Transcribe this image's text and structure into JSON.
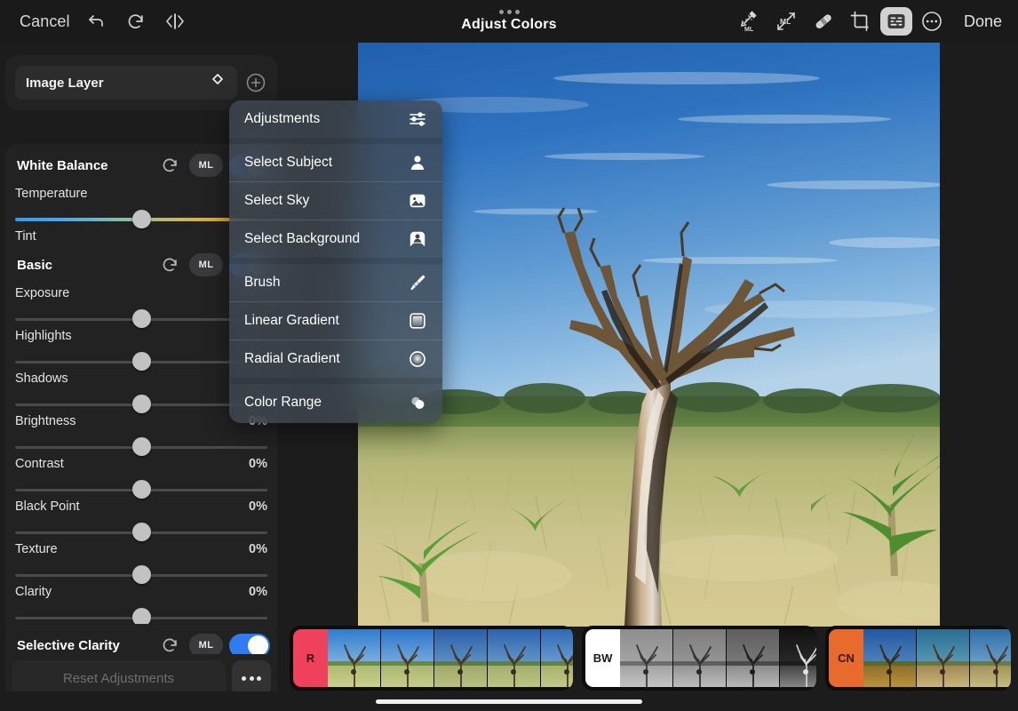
{
  "topbar": {
    "cancel_label": "Cancel",
    "done_label": "Done",
    "title": "Adjust Colors",
    "left_icons": [
      {
        "name": "undo-icon"
      },
      {
        "name": "redo-icon"
      },
      {
        "name": "compare-before-after-icon"
      }
    ],
    "right_icons": [
      {
        "name": "magic-wand-ml-icon"
      },
      {
        "name": "ml-resize-icon"
      },
      {
        "name": "healing-bandage-icon"
      },
      {
        "name": "crop-icon"
      },
      {
        "name": "adjustments-panel-icon",
        "active": true
      },
      {
        "name": "more-circle-icon"
      }
    ]
  },
  "left_panel": {
    "layer": {
      "selected": "Image Layer",
      "chevron_icon": "chevron-up-down-icon",
      "add_icon": "plus-circle-icon"
    },
    "sections": [
      {
        "id": "white-balance",
        "title": "White Balance",
        "reset_icon": "reset-arrow-icon",
        "ml_label": "ML",
        "toggle_on": true,
        "sliders": [
          {
            "label": "Temperature",
            "value": "",
            "pos": 50,
            "gradient": "temp"
          },
          {
            "label": "Tint",
            "value": "",
            "pos": 50,
            "gradient": "tint"
          }
        ]
      },
      {
        "id": "basic",
        "title": "Basic",
        "reset_icon": "reset-arrow-icon",
        "ml_label": "ML",
        "toggle_on": true,
        "sliders": [
          {
            "label": "Exposure",
            "value": "",
            "pos": 50,
            "gradient": "plain"
          },
          {
            "label": "Highlights",
            "value": "",
            "pos": 50,
            "gradient": "plain"
          },
          {
            "label": "Shadows",
            "value": "",
            "pos": 50,
            "gradient": "plain"
          },
          {
            "label": "Brightness",
            "value": "0%",
            "pos": 50,
            "gradient": "plain"
          },
          {
            "label": "Contrast",
            "value": "0%",
            "pos": 50,
            "gradient": "plain"
          },
          {
            "label": "Black Point",
            "value": "0%",
            "pos": 50,
            "gradient": "plain"
          },
          {
            "label": "Texture",
            "value": "0%",
            "pos": 50,
            "gradient": "plain"
          },
          {
            "label": "Clarity",
            "value": "0%",
            "pos": 50,
            "gradient": "plain"
          }
        ]
      },
      {
        "id": "selective-clarity",
        "title": "Selective Clarity",
        "reset_icon": "reset-arrow-icon",
        "ml_label": "ML",
        "toggle_on": true,
        "sliders": []
      }
    ],
    "footer": {
      "reset_label": "Reset Adjustments",
      "more_icon": "more-dots-icon"
    }
  },
  "menu": {
    "items": [
      {
        "label": "Adjustments",
        "icon": "sliders-icon",
        "sep_after": "gap"
      },
      {
        "label": "Select Subject",
        "icon": "person-icon",
        "sep_after": "line"
      },
      {
        "label": "Select Sky",
        "icon": "sky-image-icon",
        "sep_after": "line"
      },
      {
        "label": "Select Background",
        "icon": "background-person-icon",
        "sep_after": "gap"
      },
      {
        "label": "Brush",
        "icon": "brush-icon",
        "sep_after": "line"
      },
      {
        "label": "Linear Gradient",
        "icon": "linear-gradient-icon",
        "sep_after": "line"
      },
      {
        "label": "Radial Gradient",
        "icon": "radial-gradient-icon",
        "sep_after": "gap"
      },
      {
        "label": "Color Range",
        "icon": "color-range-icon",
        "sep_after": "none"
      }
    ]
  },
  "filmstrip": {
    "groups": [
      {
        "chip_label": "R",
        "chip_color": "#f0415c",
        "chip_text_color": "#3a0a12",
        "thumbs": [
          {
            "name": "preset-r-1",
            "sky_top": "#2f7ccd",
            "sky_bot": "#7fb3e0",
            "ground_top": "#a8b870",
            "ground_bot": "#ccd08a"
          },
          {
            "name": "preset-r-2",
            "sky_top": "#2b73c9",
            "sky_bot": "#79aede",
            "ground_top": "#a5b56e",
            "ground_bot": "#c9cd88"
          },
          {
            "name": "preset-r-3",
            "sky_top": "#2a5fa8",
            "sky_bot": "#5f93c4",
            "ground_top": "#9aa868",
            "ground_bot": "#bcc07e"
          },
          {
            "name": "preset-r-4",
            "sky_top": "#2c63ad",
            "sky_bot": "#6599c9",
            "ground_top": "#9eac6b",
            "ground_bot": "#c0c482"
          },
          {
            "name": "preset-r-5",
            "sky_top": "#2e69b5",
            "sky_bot": "#6c9fd0",
            "ground_top": "#a2b06d",
            "ground_bot": "#c4c884"
          }
        ]
      },
      {
        "chip_label": "BW",
        "chip_color": "#ffffff",
        "chip_text_color": "#1a1a1a",
        "thumbs": [
          {
            "name": "preset-bw-1",
            "sky_top": "#8e8e8e",
            "sky_bot": "#a5a5a5",
            "ground_top": "#9e9e9e",
            "ground_bot": "#c4c4c4"
          },
          {
            "name": "preset-bw-2",
            "sky_top": "#7d7d7d",
            "sky_bot": "#969696",
            "ground_top": "#8f8f8f",
            "ground_bot": "#bcbcbc"
          },
          {
            "name": "preset-bw-3",
            "sky_top": "#5e5e5e",
            "sky_bot": "#7a7a7a",
            "ground_top": "#868686",
            "ground_bot": "#b8b8b8"
          },
          {
            "name": "preset-bw-4",
            "sky_top": "#111111",
            "sky_bot": "#2a2a2a",
            "ground_top": "#3a3a3a",
            "ground_bot": "#858585"
          }
        ]
      },
      {
        "chip_label": "CN",
        "chip_color": "#e86a2c",
        "chip_text_color": "#3a1a06",
        "thumbs": [
          {
            "name": "preset-cn-1",
            "sky_top": "#2357a0",
            "sky_bot": "#4e86bd",
            "ground_top": "#8a6a28",
            "ground_bot": "#b9933c"
          },
          {
            "name": "preset-cn-2",
            "sky_top": "#2a6d93",
            "sky_bot": "#5a9ab5",
            "ground_top": "#9b8350",
            "ground_bot": "#cbb57e"
          },
          {
            "name": "preset-cn-3",
            "sky_top": "#2e6fa8",
            "sky_bot": "#6ba0c9",
            "ground_top": "#9c8e55",
            "ground_bot": "#c8bb80"
          }
        ]
      }
    ]
  },
  "photo": {
    "alt": "dead-bare-tree-in-dry-grass-field-under-blue-sky"
  },
  "colors": {
    "accent_blue": "#2f7bf0",
    "panel_bg": "#222222",
    "app_bg": "#1c1c1c",
    "topbar_bg": "#1a1a1a"
  }
}
